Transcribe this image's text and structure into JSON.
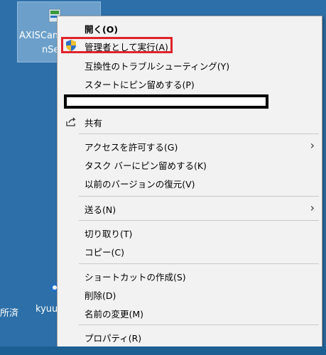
{
  "desktop": {
    "icon_label_1": "AXISCam",
    "icon_label_2": "nSe",
    "icon2_label": "kyuu",
    "left_label": "所済"
  },
  "menu": {
    "open": "開く(O)",
    "run_as_admin": "管理者として実行(A)",
    "troubleshoot": "互換性のトラブルシューティング(Y)",
    "pin_start": "スタートにピン留めする(P)",
    "share": "共有",
    "give_access": "アクセスを許可する(G)",
    "pin_taskbar": "タスク バーにピン留めする(K)",
    "restore_versions": "以前のバージョンの復元(V)",
    "send_to": "送る(N)",
    "cut": "切り取り(T)",
    "copy": "コピー(C)",
    "create_shortcut": "ショートカットの作成(S)",
    "delete": "削除(D)",
    "rename": "名前の変更(M)",
    "properties": "プロパティ(R)"
  },
  "colors": {
    "highlight_box": "#e0232c",
    "menu_bg": "#f2f2f2"
  }
}
